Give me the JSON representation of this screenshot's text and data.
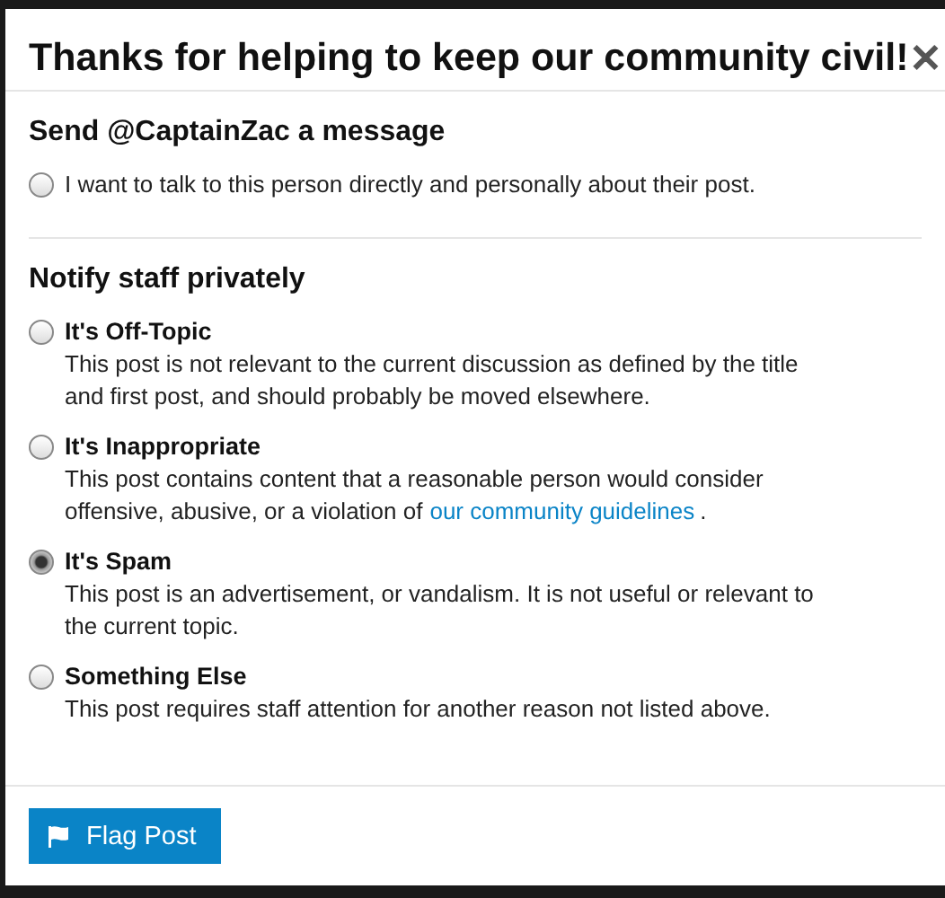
{
  "dialog": {
    "title": "Thanks for helping to keep our community civil!",
    "close": "✕"
  },
  "message_section": {
    "heading": "Send @CaptainZac a message",
    "option": {
      "label": "I want to talk to this person directly and personally about their post.",
      "selected": false
    }
  },
  "notify_section": {
    "heading": "Notify staff privately",
    "options": [
      {
        "label": "It's Off-Topic",
        "description": "This post is not relevant to the current discussion as defined by the title and first post, and should probably be moved elsewhere.",
        "selected": false
      },
      {
        "label": "It's Inappropriate",
        "description": "This post contains content that a reasonable person would consider offensive, abusive, or a violation of",
        "link": "our community guidelines",
        "tail": ".",
        "selected": false
      },
      {
        "label": "It's Spam",
        "description": "This post is an advertisement, or vandalism. It is not useful or relevant to the current topic.",
        "selected": true
      },
      {
        "label": "Something Else",
        "description": "This post requires staff attention for another reason not listed above.",
        "selected": false
      }
    ]
  },
  "footer": {
    "button": "Flag Post"
  }
}
